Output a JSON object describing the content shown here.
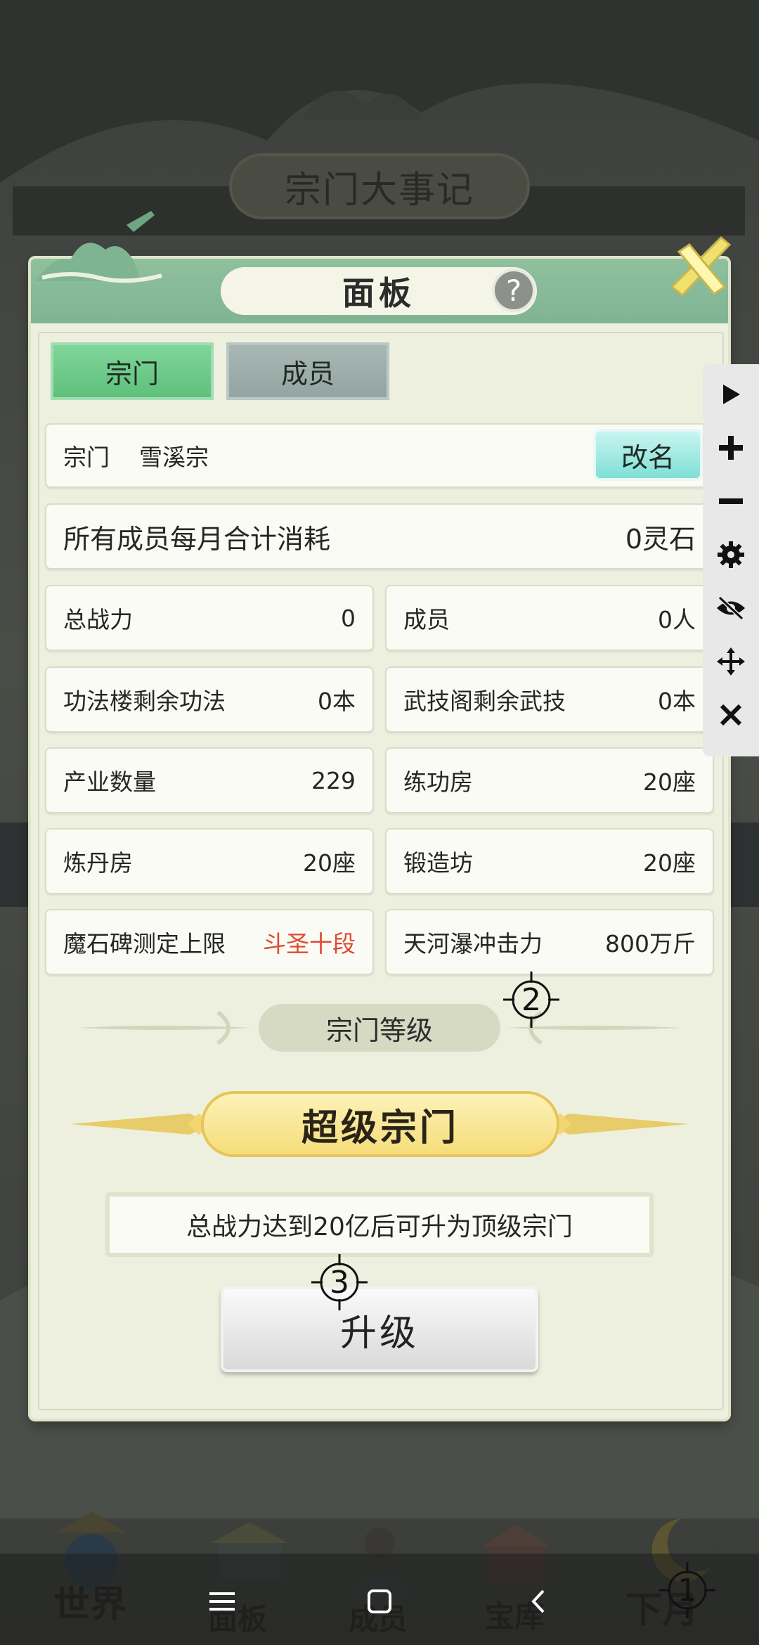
{
  "background": {
    "title": "宗门大事记"
  },
  "panel": {
    "title": "面板",
    "help_icon": "?",
    "tabs": [
      {
        "label": "宗门",
        "active": true
      },
      {
        "label": "成员",
        "active": false
      }
    ],
    "sect_row": {
      "label": "宗门",
      "value": "雪溪宗",
      "rename_label": "改名"
    },
    "monthly_row": {
      "label": "所有成员每月合计消耗",
      "value": "0灵石"
    },
    "stats": [
      {
        "label": "总战力",
        "value": "0"
      },
      {
        "label": "成员",
        "value": "0人"
      },
      {
        "label": "功法楼剩余功法",
        "value": "0本"
      },
      {
        "label": "武技阁剩余武技",
        "value": "0本"
      },
      {
        "label": "产业数量",
        "value": "229"
      },
      {
        "label": "练功房",
        "value": "20座"
      },
      {
        "label": "炼丹房",
        "value": "20座"
      },
      {
        "label": "锻造坊",
        "value": "20座"
      },
      {
        "label": "魔石碑测定上限",
        "value": "斗圣十段"
      },
      {
        "label": "天河瀑冲击力",
        "value": "800万斤"
      }
    ],
    "section_label": "宗门等级",
    "rank": "超级宗门",
    "hint": "总战力达到20亿后可升为顶级宗门",
    "upgrade_label": "升级"
  },
  "markers": [
    "1",
    "2",
    "3"
  ],
  "floating_toolbar": [
    "play-icon",
    "plus-icon",
    "minus-icon",
    "gear-icon",
    "eye-off-icon",
    "move-icon",
    "close-icon"
  ],
  "game_nav": [
    {
      "label": "世界"
    },
    {
      "label": "面板"
    },
    {
      "label": "成员"
    },
    {
      "label": "宝库"
    },
    {
      "label": "下月"
    }
  ],
  "colors": {
    "accent_green": "#5fc07c",
    "warning_red": "#e04a35",
    "gold": "#f5dd7a"
  }
}
